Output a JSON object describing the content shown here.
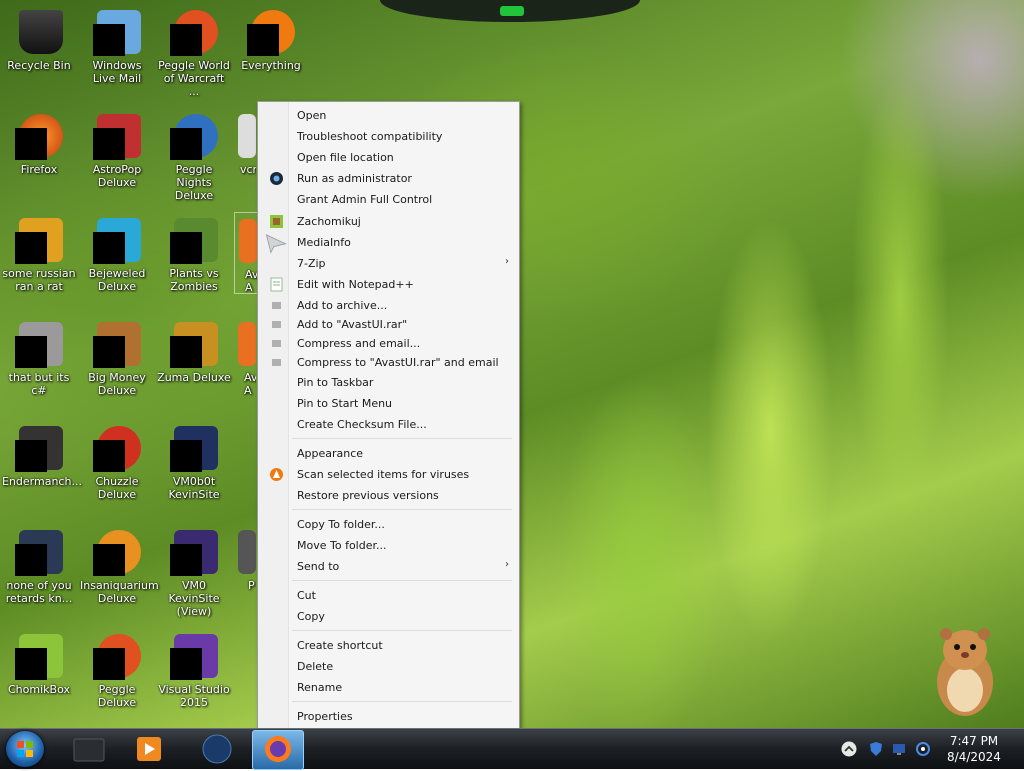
{
  "desktop": {
    "icons": [
      {
        "label": "Recycle Bin"
      },
      {
        "label": "Windows Live Mail"
      },
      {
        "label": "Peggle World of Warcraft ..."
      },
      {
        "label": "Everything"
      },
      {
        "label": "Firefox"
      },
      {
        "label": "AstroPop Deluxe"
      },
      {
        "label": "Peggle Nights Deluxe"
      },
      {
        "label": "vcre"
      },
      {
        "label": "some russian ran a rat"
      },
      {
        "label": "Bejeweled Deluxe"
      },
      {
        "label": "Plants vs Zombies"
      },
      {
        "label": "Av A"
      },
      {
        "label": "that but its c#"
      },
      {
        "label": "Big Money Deluxe"
      },
      {
        "label": "Zuma Deluxe"
      },
      {
        "label": "Av A"
      },
      {
        "label": "Endermanch..."
      },
      {
        "label": "Chuzzle Deluxe"
      },
      {
        "label": "VM0b0t KevinSite"
      },
      {
        "label": "none of you retards kn..."
      },
      {
        "label": "Insaniquarium Deluxe"
      },
      {
        "label": "VM0 KevinSite (View)"
      },
      {
        "label": "P"
      },
      {
        "label": "ChomikBox"
      },
      {
        "label": "Peggle Deluxe"
      },
      {
        "label": "Visual Studio 2015"
      }
    ]
  },
  "context_menu": {
    "items": [
      {
        "label": "Open",
        "icon": ""
      },
      {
        "label": "Troubleshoot compatibility",
        "icon": ""
      },
      {
        "label": "Open file location",
        "icon": ""
      },
      {
        "label": "Run as administrator",
        "icon": "shield-icon"
      },
      {
        "label": "Grant Admin Full Control",
        "icon": ""
      },
      {
        "label": "Zachomikuj",
        "icon": "chomikuj-icon"
      },
      {
        "label": "MediaInfo",
        "icon": "mediainfo-icon"
      },
      {
        "label": "7-Zip",
        "icon": "",
        "submenu_arrow": "›"
      },
      {
        "label": "Edit with Notepad++",
        "icon": "notepad-icon"
      },
      {
        "label": "Add to archive...",
        "icon": "archive-icon"
      },
      {
        "label": "Add to \"AvastUI.rar\"",
        "icon": "archive-icon"
      },
      {
        "label": "Compress and email...",
        "icon": "archive-icon"
      },
      {
        "label": "Compress to \"AvastUI.rar\" and email",
        "icon": "archive-icon"
      },
      {
        "label": "Pin to Taskbar",
        "icon": ""
      },
      {
        "label": "Pin to Start Menu",
        "icon": ""
      },
      {
        "label": "Create Checksum File...",
        "icon": ""
      },
      {
        "label": "Appearance",
        "icon": ""
      },
      {
        "label": "Scan selected items for viruses",
        "icon": "avast-icon"
      },
      {
        "label": "Restore previous versions",
        "icon": ""
      },
      {
        "label": "Copy To folder...",
        "icon": ""
      },
      {
        "label": "Move To folder...",
        "icon": ""
      },
      {
        "label": "Send to",
        "icon": "",
        "submenu_arrow": "›"
      },
      {
        "label": "Cut",
        "icon": ""
      },
      {
        "label": "Copy",
        "icon": ""
      },
      {
        "label": "Create shortcut",
        "icon": ""
      },
      {
        "label": "Delete",
        "icon": ""
      },
      {
        "label": "Rename",
        "icon": ""
      },
      {
        "label": "Properties",
        "icon": ""
      }
    ]
  },
  "taskbar": {
    "buttons": [
      {
        "name": "start-button"
      },
      {
        "name": "taskbar-app-1"
      },
      {
        "name": "taskbar-app-media-player"
      },
      {
        "name": "taskbar-app-3"
      },
      {
        "name": "taskbar-app-firefox",
        "active": true
      }
    ],
    "tray_icons": [
      "chevron-up-icon",
      "shield-icon",
      "network-icon",
      "sync-icon"
    ],
    "clock": {
      "time": "7:47 PM",
      "date": "8/4/2024"
    }
  },
  "colors": {
    "menu_background": "#f5f5f5",
    "taskbar": "#1c2024",
    "accent_green": "#22c43a"
  }
}
